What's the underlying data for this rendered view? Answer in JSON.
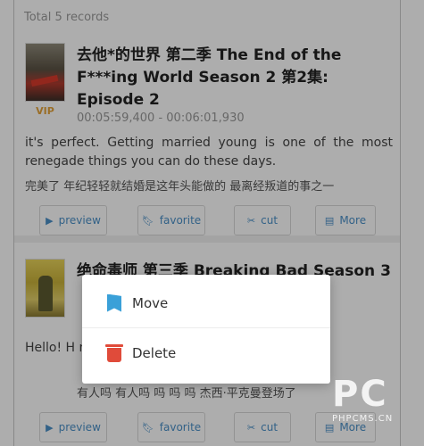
{
  "header": {
    "total_label": "Total 5 records"
  },
  "records": [
    {
      "title": "去他*的世界 第二季 The End of the F***ing World Season 2 第2集: Episode 2",
      "badge": "VIP",
      "time_range": "00:05:59,400 - 00:06:01,930",
      "subtitle_en": "it's perfect. Getting married young is one of the most renegade things you can do these days.",
      "subtitle_zh": "完美了 年纪轻轻就结婚是这年头能做的 最离经叛道的事之一"
    },
    {
      "title": "绝命毒师 第三季 Breaking Bad Season 3",
      "subtitle_en": "Hello! H                                              nkman in the hous",
      "subtitle_zh": "有人吗 有人吗  吗  吗  吗 杰西·平克曼登场了"
    }
  ],
  "actions": {
    "preview": "preview",
    "favorite": "favorite",
    "cut": "cut",
    "more": "More"
  },
  "menu": {
    "move": "Move",
    "delete": "Delete"
  },
  "watermark": {
    "big": "PC",
    "small": "PHPCMS.CN"
  },
  "colors": {
    "accent": "#4a90c8",
    "vip": "#e3a23a",
    "delete": "#e04b3a",
    "move": "#3aa0d8"
  }
}
